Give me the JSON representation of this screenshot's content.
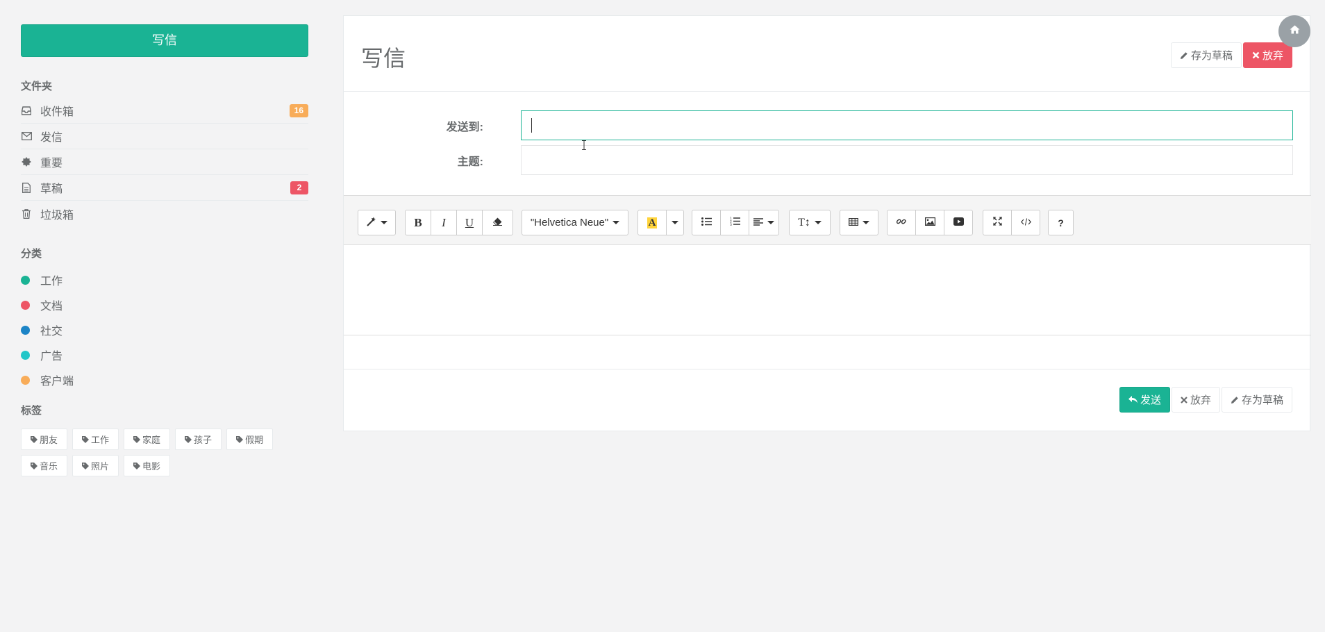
{
  "sidebar": {
    "compose_label": "写信",
    "folders_title": "文件夹",
    "folders": [
      {
        "label": "收件箱",
        "icon": "inbox-icon",
        "badge": "16",
        "badge_color": "#f8ac59"
      },
      {
        "label": "发信",
        "icon": "envelope-icon",
        "badge": null
      },
      {
        "label": "重要",
        "icon": "certificate-icon",
        "badge": null
      },
      {
        "label": "草稿",
        "icon": "file-text-icon",
        "badge": "2",
        "badge_color": "#ed5565"
      },
      {
        "label": "垃圾箱",
        "icon": "trash-icon",
        "badge": null
      }
    ],
    "categories_title": "分类",
    "categories": [
      {
        "label": "工作",
        "color": "#1ab394"
      },
      {
        "label": "文档",
        "color": "#ed5565"
      },
      {
        "label": "社交",
        "color": "#1c84c6"
      },
      {
        "label": "广告",
        "color": "#23c6c8"
      },
      {
        "label": "客户端",
        "color": "#f8ac59"
      }
    ],
    "tags_title": "标签",
    "tags": [
      "朋友",
      "工作",
      "家庭",
      "孩子",
      "假期",
      "音乐",
      "照片",
      "电影"
    ]
  },
  "main": {
    "title": "写信",
    "save_draft_label": "存为草稿",
    "discard_label": "放弃",
    "to_label": "发送到:",
    "to_value": "",
    "subject_label": "主题:",
    "subject_value": "",
    "font_name": "\"Helvetica Neue\"",
    "send_label": "发送",
    "footer_discard_label": "放弃",
    "footer_save_draft_label": "存为草稿"
  },
  "colors": {
    "primary": "#1ab394",
    "danger": "#ed5565",
    "warning": "#f8ac59"
  }
}
